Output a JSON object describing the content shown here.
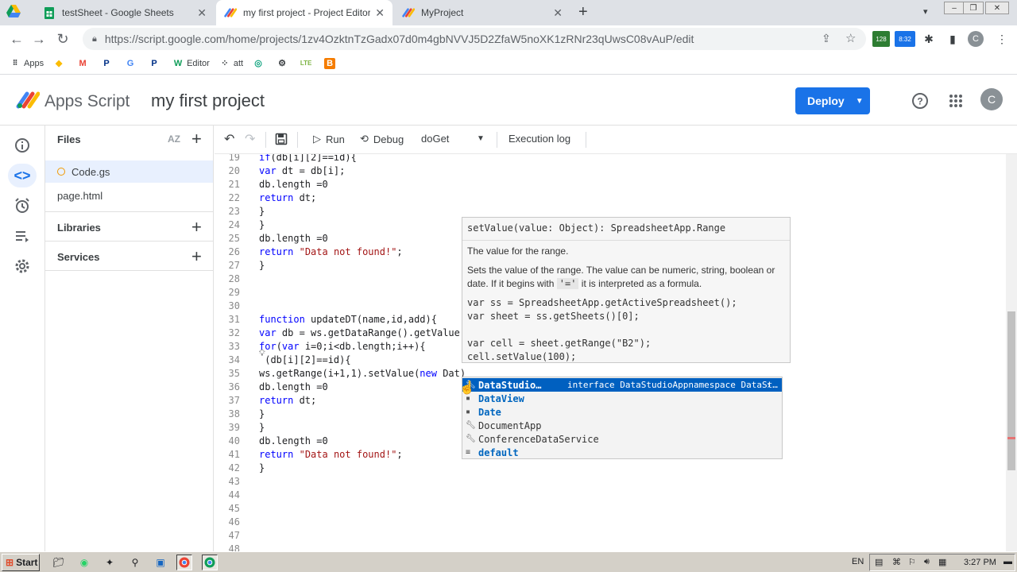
{
  "browser": {
    "tabs": [
      {
        "title": "testSheet - Google Sheets",
        "icon": "sheets-icon",
        "active": false
      },
      {
        "title": "my first project - Project Editor - Ap",
        "icon": "apps-script-icon",
        "active": true
      },
      {
        "title": "MyProject",
        "icon": "apps-script-icon",
        "active": false
      }
    ],
    "url": "https://script.google.com/home/projects/1zv4OzktnTzGadx07d0m4gbNVVJ5D2ZfaW5noXK1zRNr23qUwsC08vAuP/edit",
    "extension_badges": {
      "badge_1": "128",
      "badge_2": "8:32"
    },
    "profile_initial": "C",
    "bookmarks": [
      "Apps",
      "",
      "",
      "",
      "",
      "",
      "Editor",
      "att",
      "",
      "",
      "",
      ""
    ]
  },
  "app": {
    "name": "Apps Script",
    "project": "my first project",
    "deploy_label": "Deploy",
    "avatar_initial": "C"
  },
  "files_panel": {
    "files_heading": "Files",
    "sort_label": "AZ",
    "files": [
      "Code.gs",
      "page.html"
    ],
    "libraries_heading": "Libraries",
    "services_heading": "Services"
  },
  "editor_toolbar": {
    "run": "Run",
    "debug": "Debug",
    "function": "doGet",
    "execution_log": "Execution log"
  },
  "code": {
    "line_numbers": [
      "19",
      "20",
      "21",
      "22",
      "23",
      "24",
      "25",
      "26",
      "27",
      "28",
      "29",
      "30",
      "31",
      "32",
      "33",
      "34",
      "35",
      "36",
      "37",
      "38",
      "39",
      "40",
      "41",
      "42",
      "43",
      "44",
      "45",
      "46",
      "47",
      "48"
    ],
    "lines": [
      "if(db[i][2]==id){",
      "var dt = db[i];",
      "db.length =0",
      "return dt;",
      "}",
      "}",
      "db.length =0",
      "return \"Data not found!\";",
      "}",
      "",
      "",
      "",
      "function updateDT(name,id,add){",
      "var db = ws.getDataRange().getValue",
      "for(var i=0;i<db.length;i++){",
      " (db[i][2]==id){",
      "ws.getRange(i+1,1).setValue(new Dat)",
      "db.length =0",
      "return dt;",
      "}",
      "}",
      "db.length =0",
      "return \"Data not found!\";",
      "}",
      "",
      "",
      "",
      "",
      "",
      ""
    ]
  },
  "tooltip": {
    "signature": "setValue(value: Object): SpreadsheetApp.Range",
    "summary": "The value for the range.",
    "description_1": "Sets the value of the range. The value can be numeric, string, boolean or",
    "description_2a": "date. If it begins with",
    "description_code": "'='",
    "description_2b": "it is interpreted as a formula.",
    "example": [
      "var ss = SpreadsheetApp.getActiveSpreadsheet();",
      "var sheet = ss.getSheets()[0];",
      "",
      "var cell = sheet.getRange(\"B2\");",
      "cell.setValue(100);"
    ]
  },
  "suggestions": {
    "items": [
      "DataStudio…",
      "DataView",
      "Date",
      "DocumentApp",
      "ConferenceDataService",
      "default"
    ],
    "selected_detail": "interface DataStudioAppnamespace DataSt…"
  },
  "taskbar": {
    "start": "Start",
    "lang": "EN",
    "clock": "3:27 PM"
  },
  "colors": {
    "deploy_blue": "#1a73e8",
    "suggest_selected": "#0060c0",
    "keyword": "#0000ff",
    "string": "#a31515"
  }
}
